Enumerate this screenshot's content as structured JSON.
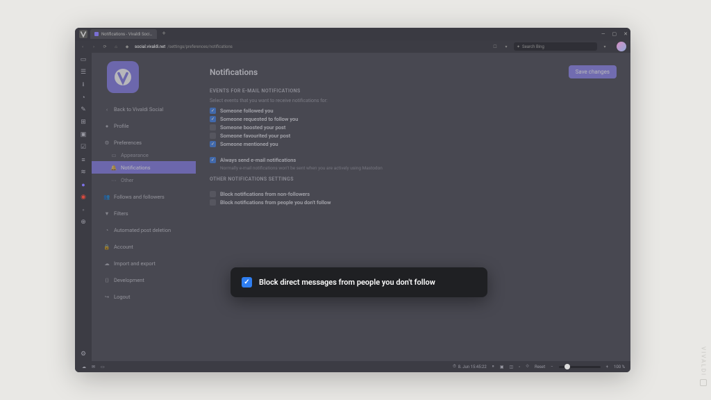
{
  "tab": {
    "title": "Notifications - Vivaldi Soci…"
  },
  "url": {
    "host": "social.vivaldi.net",
    "path": "/settings/preferences/notifications"
  },
  "search": {
    "placeholder": "Search Bing"
  },
  "sidebar": {
    "back": "Back to Vivaldi Social",
    "items": [
      {
        "label": "Profile"
      },
      {
        "label": "Preferences"
      },
      {
        "label": "Appearance"
      },
      {
        "label": "Notifications"
      },
      {
        "label": "Other"
      },
      {
        "label": "Follows and followers"
      },
      {
        "label": "Filters"
      },
      {
        "label": "Automated post deletion"
      },
      {
        "label": "Account"
      },
      {
        "label": "Import and export"
      },
      {
        "label": "Development"
      },
      {
        "label": "Logout"
      }
    ]
  },
  "header": {
    "title": "Notifications",
    "save": "Save changes"
  },
  "section1": {
    "title": "EVENTS FOR E-MAIL NOTIFICATIONS",
    "desc": "Select events that you want to receive notifications for:",
    "opts": [
      {
        "label": "Someone followed you",
        "checked": true
      },
      {
        "label": "Someone requested to follow you",
        "checked": true
      },
      {
        "label": "Someone boosted your post",
        "checked": false
      },
      {
        "label": "Someone favourited your post",
        "checked": false
      },
      {
        "label": "Someone mentioned you",
        "checked": true
      }
    ],
    "always": {
      "label": "Always send e-mail notifications",
      "checked": true,
      "note": "Normally e-mail notifications won't be sent when you are actively using Mastodon"
    }
  },
  "section2": {
    "title": "OTHER NOTIFICATIONS SETTINGS",
    "opts": [
      {
        "label": "Block notifications from non-followers",
        "checked": false
      },
      {
        "label": "Block notifications from people you don't follow",
        "checked": false
      }
    ]
  },
  "callout": {
    "label": "Block direct messages from people you don't follow",
    "checked": true
  },
  "status": {
    "clock": "8. Jun 15:45:22",
    "reset": "Reset",
    "zoom": "100 %"
  },
  "watermark": "VIVALDI"
}
